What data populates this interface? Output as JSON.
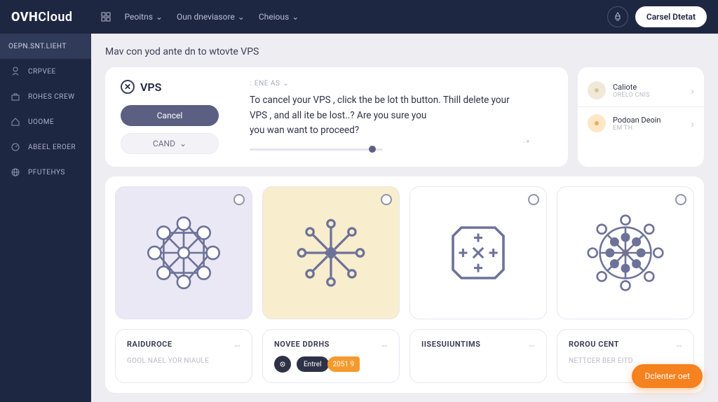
{
  "brand": {
    "prefix": "OVH",
    "suffix": "Cloud"
  },
  "topnav": {
    "links": [
      {
        "label": "Peoitns"
      },
      {
        "label": "Oun dneviasore"
      },
      {
        "label": "Cheious"
      }
    ],
    "cta": "Carsel Dtetat"
  },
  "sidebar": {
    "header": "OEPN.SNT.LIEHT",
    "items": [
      {
        "label": "CRPVEE"
      },
      {
        "label": "ROHES CREW"
      },
      {
        "label": "UOOME"
      },
      {
        "label": "ABEEL EROER"
      },
      {
        "label": "PFUTEHYS"
      }
    ]
  },
  "page_title": "Mav con yod ante dn to wtovte VPS",
  "vps": {
    "title": "VPS",
    "cancel_label": "Cancel",
    "cand_label": "CAND",
    "tag": "ENE AS",
    "body_line1": "To cancel your VPS , click the be lot th button. Thill delete your",
    "body_line2": "VPS , and all ite be lost..?   Are you sure you",
    "body_line3": "you wan want to proceed?",
    "progress_label": ". »"
  },
  "right": {
    "items": [
      {
        "title": "Caliote",
        "sub": "ORELO CNIS"
      },
      {
        "title": "Podoan Deoin",
        "sub": "EM TH"
      }
    ]
  },
  "tiles": {
    "mini": [
      {
        "title": "RAIDUROCE",
        "sub": "GOOL NAEL YOR NIAULE"
      },
      {
        "title": "NOVEE DDRHS",
        "chip_dark": "Entrel",
        "chip_orange": "2051 9"
      },
      {
        "title": "IISESUIUNTIMS"
      },
      {
        "title": "ROROU CENT",
        "sub": "NETTCER BER EITD"
      }
    ]
  },
  "fab": "Dclenter oet"
}
